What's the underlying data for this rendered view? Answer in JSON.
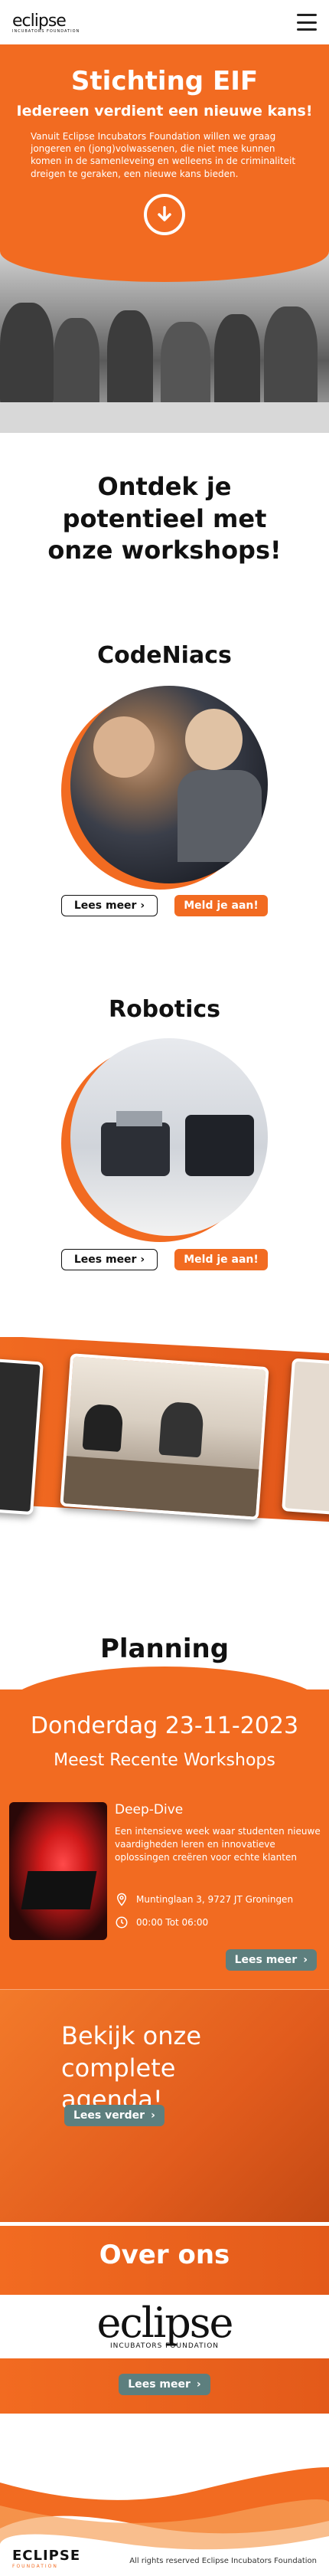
{
  "header": {
    "logo_text": "eclipse",
    "logo_sub": "INCUBATORS FOUNDATION",
    "menu_icon": "hamburger-icon"
  },
  "hero": {
    "title": "Stichting EIF",
    "subtitle": "Iedereen verdient een nieuwe kans!",
    "text": "Vanuit Eclipse Incubators Foundation willen we graag jongeren en (jong)volwassenen, die niet mee kunnen komen in de samenleveing en welleens in de criminaliteit dreigen te geraken, een nieuwe kans bieden.",
    "scroll_icon": "arrow-down-circle-icon"
  },
  "workshops": {
    "heading": "Ontdek je potentieel met onze workshops!",
    "items": [
      {
        "title": "CodeNiacs",
        "more_label": "Lees meer",
        "signup_label": "Meld je aan!"
      },
      {
        "title": "Robotics",
        "more_label": "Lees meer",
        "signup_label": "Meld je aan!"
      }
    ]
  },
  "planning": {
    "heading": "Planning",
    "date": "Donderdag 23-11-2023",
    "subheading": "Meest Recente Workshops",
    "event": {
      "title": "Deep-Dive",
      "description": "Een intensieve week waar studenten nieuwe vaardigheden leren en innovatieve oplossingen creëren voor echte klanten",
      "location": "Muntinglaan 3, 9727 JT Groningen",
      "time": "00:00 Tot 06:00",
      "more_label": "Lees meer"
    },
    "agenda_title": "Bekijk onze complete agenda!",
    "agenda_button": "Lees verder"
  },
  "about": {
    "heading": "Over ons",
    "logo_text": "eclipse",
    "logo_sub": "INCUBATORS FOUNDATION",
    "button": "Lees meer"
  },
  "footer": {
    "logo_text": "ECLIPSE",
    "logo_sub": "FOUNDATION",
    "rights": "All rights reserved Eclipse Incubators Foundation"
  },
  "colors": {
    "accent": "#f26b21",
    "button_grey": "#5d7f7e"
  }
}
